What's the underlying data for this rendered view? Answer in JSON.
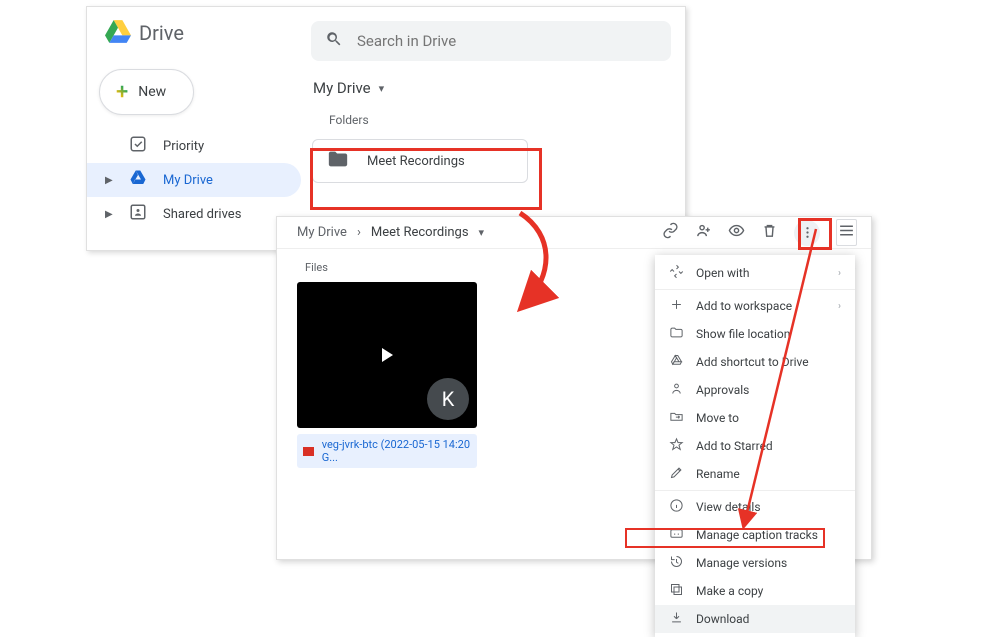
{
  "app": {
    "title": "Drive"
  },
  "search": {
    "placeholder": "Search in Drive"
  },
  "sidebar": {
    "new_label": "New",
    "items": [
      {
        "label": "Priority"
      },
      {
        "label": "My Drive"
      },
      {
        "label": "Shared drives"
      }
    ]
  },
  "main1": {
    "breadcrumb": "My Drive",
    "folders_label": "Folders",
    "folder_name": "Meet Recordings"
  },
  "main2": {
    "crumb_root": "My Drive",
    "crumb_current": "Meet Recordings",
    "files_label": "Files",
    "avatar_initial": "K",
    "video_filename": "veg-jvrk-btc (2022-05-15 14:20 G..."
  },
  "context_menu": {
    "open_with": "Open with",
    "add_workspace": "Add to workspace",
    "show_location": "Show file location",
    "add_shortcut": "Add shortcut to Drive",
    "approvals": "Approvals",
    "move_to": "Move to",
    "add_starred": "Add to Starred",
    "rename": "Rename",
    "view_details": "View details",
    "manage_captions": "Manage caption tracks",
    "manage_versions": "Manage versions",
    "make_copy": "Make a copy",
    "download": "Download"
  }
}
